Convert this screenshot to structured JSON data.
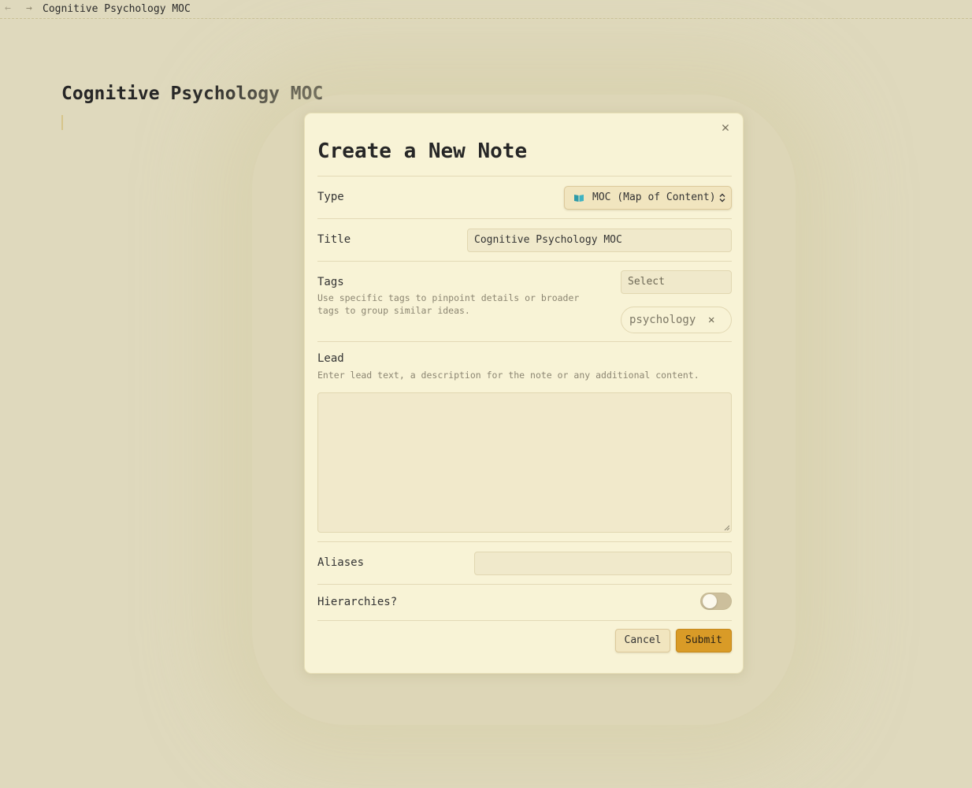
{
  "topbar": {
    "back_icon": "arrow-left-icon",
    "forward_icon": "arrow-right-icon",
    "tab_title": "Cognitive Psychology MOC"
  },
  "note": {
    "title": "Cognitive Psychology MOC"
  },
  "modal": {
    "title": "Create a New Note",
    "close_icon": "close-icon",
    "type": {
      "label": "Type",
      "selected": "MOC (Map of Content)",
      "icon": "open-book-icon"
    },
    "title_field": {
      "label": "Title",
      "value": "Cognitive Psychology MOC"
    },
    "tags": {
      "label": "Tags",
      "description": "Use specific tags to pinpoint details or broader tags to group similar ideas.",
      "select_placeholder": "Select",
      "items": [
        {
          "label": "psychology",
          "remove_icon": "close-icon"
        }
      ]
    },
    "lead": {
      "label": "Lead",
      "description": "Enter lead text, a description for the note or any additional content.",
      "value": ""
    },
    "aliases": {
      "label": "Aliases",
      "value": ""
    },
    "hierarchies": {
      "label": "Hierarchies?",
      "enabled": false
    },
    "buttons": {
      "cancel": "Cancel",
      "submit": "Submit"
    }
  },
  "colors": {
    "background": "#dfd9bd",
    "modal": "#f8f3d6",
    "accent": "#d99b27"
  }
}
